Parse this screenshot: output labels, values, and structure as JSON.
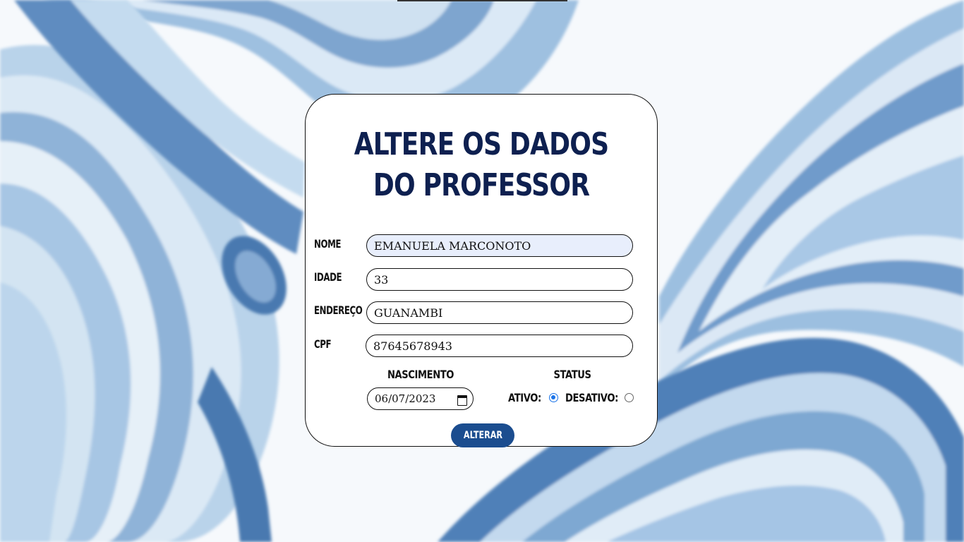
{
  "page": {
    "title": "ALTERE OS DADOS DO PROFESSOR"
  },
  "form": {
    "fields": [
      {
        "label": "NOME",
        "value": "EMANUELA MARCONOTO"
      },
      {
        "label": "IDADE",
        "value": "33"
      },
      {
        "label": "ENDEREÇO",
        "value": "GUANAMBI"
      },
      {
        "label": "CPF",
        "value": "87645678943"
      }
    ],
    "birth": {
      "label": "NASCIMENTO",
      "value": "06/07/2023"
    },
    "status": {
      "label": "STATUS",
      "active_label": "ATIVO:",
      "inactive_label": "DESATIVO:",
      "selected": "ATIVO"
    },
    "submit_label": "ALTERAR"
  },
  "colors": {
    "title": "#0e2050",
    "button": "#1b4d8f",
    "autofill": "#e8eefc",
    "radio_accent": "#1a73e8"
  }
}
